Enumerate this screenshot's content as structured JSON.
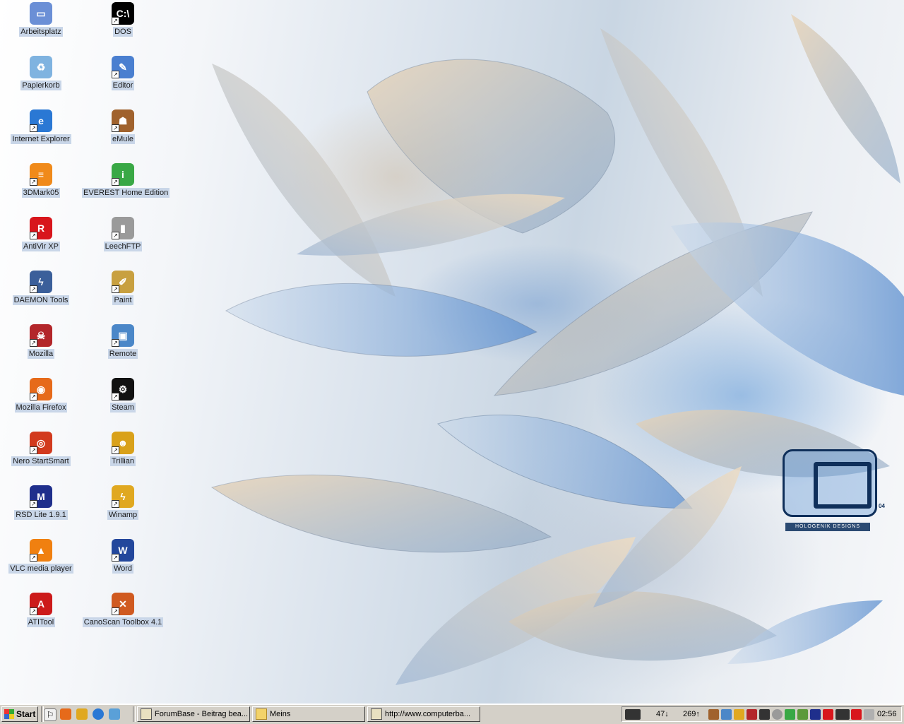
{
  "desktop": {
    "wallpaper": {
      "brand_text": "HOLOGENIK DESIGNS",
      "logo_number": "04"
    },
    "icons": [
      {
        "label": "Arbeitsplatz",
        "icon": "my-computer-icon",
        "color": "#6b8fd6",
        "glyph": "▭"
      },
      {
        "label": "DOS",
        "icon": "command-prompt-icon",
        "color": "#000000",
        "glyph": "C:\\"
      },
      {
        "label": "Papierkorb",
        "icon": "recycle-bin-icon",
        "color": "#7fb3e0",
        "glyph": "♻"
      },
      {
        "label": "Editor",
        "icon": "notepad-icon",
        "color": "#4a7fd0",
        "glyph": "✎"
      },
      {
        "label": "Internet Explorer",
        "icon": "internet-explorer-icon",
        "color": "#2a78d4",
        "glyph": "e"
      },
      {
        "label": "eMule",
        "icon": "emule-icon",
        "color": "#a0622d",
        "glyph": "☗"
      },
      {
        "label": "3DMark05",
        "icon": "3dmark-icon",
        "color": "#f08a1a",
        "glyph": "≡"
      },
      {
        "label": "EVEREST Home Edition",
        "icon": "everest-icon",
        "color": "#39a845",
        "glyph": "i"
      },
      {
        "label": "AntiVir XP",
        "icon": "antivir-icon",
        "color": "#d8161c",
        "glyph": "R"
      },
      {
        "label": "LeechFTP",
        "icon": "leechftp-icon",
        "color": "#9a9a9a",
        "glyph": "▮"
      },
      {
        "label": "DAEMON Tools",
        "icon": "daemon-tools-icon",
        "color": "#3b5f9a",
        "glyph": "ϟ"
      },
      {
        "label": "Paint",
        "icon": "paint-icon",
        "color": "#c8a040",
        "glyph": "✐"
      },
      {
        "label": "Mozilla",
        "icon": "mozilla-icon",
        "color": "#b3262a",
        "glyph": "☠"
      },
      {
        "label": "Remote",
        "icon": "remote-desktop-icon",
        "color": "#4b87c8",
        "glyph": "▣"
      },
      {
        "label": "Mozilla Firefox",
        "icon": "firefox-icon",
        "color": "#e66a1a",
        "glyph": "◉"
      },
      {
        "label": "Steam",
        "icon": "steam-icon",
        "color": "#111111",
        "glyph": "⚙"
      },
      {
        "label": "Nero StartSmart",
        "icon": "nero-icon",
        "color": "#d23a1e",
        "glyph": "◎"
      },
      {
        "label": "Trillian",
        "icon": "trillian-icon",
        "color": "#d9a11a",
        "glyph": "☻"
      },
      {
        "label": "RSD Lite 1.9.1",
        "icon": "motorola-icon",
        "color": "#1f2f8c",
        "glyph": "M"
      },
      {
        "label": "Winamp",
        "icon": "winamp-icon",
        "color": "#e0a820",
        "glyph": "ϟ"
      },
      {
        "label": "VLC media player",
        "icon": "vlc-icon",
        "color": "#f08010",
        "glyph": "▲"
      },
      {
        "label": "Word",
        "icon": "word-icon",
        "color": "#23479c",
        "glyph": "W"
      },
      {
        "label": "ATITool",
        "icon": "atitool-icon",
        "color": "#cc1a1a",
        "glyph": "A"
      },
      {
        "label": "CanoScan Toolbox 4.1",
        "icon": "canoscan-icon",
        "color": "#d05a20",
        "glyph": "✕"
      }
    ]
  },
  "taskbar": {
    "start_label": "Start",
    "tasks": [
      {
        "label": "ForumBase - Beitrag bea...",
        "icon": "browser-window-icon"
      },
      {
        "label": "Meins",
        "icon": "folder-icon"
      },
      {
        "label": "http://www.computerba...",
        "icon": "browser-window-icon"
      }
    ],
    "tray": {
      "down_value": "47",
      "down_arrow": "↓",
      "up_value": "269",
      "up_arrow": "↑",
      "clock": "02:56"
    }
  }
}
